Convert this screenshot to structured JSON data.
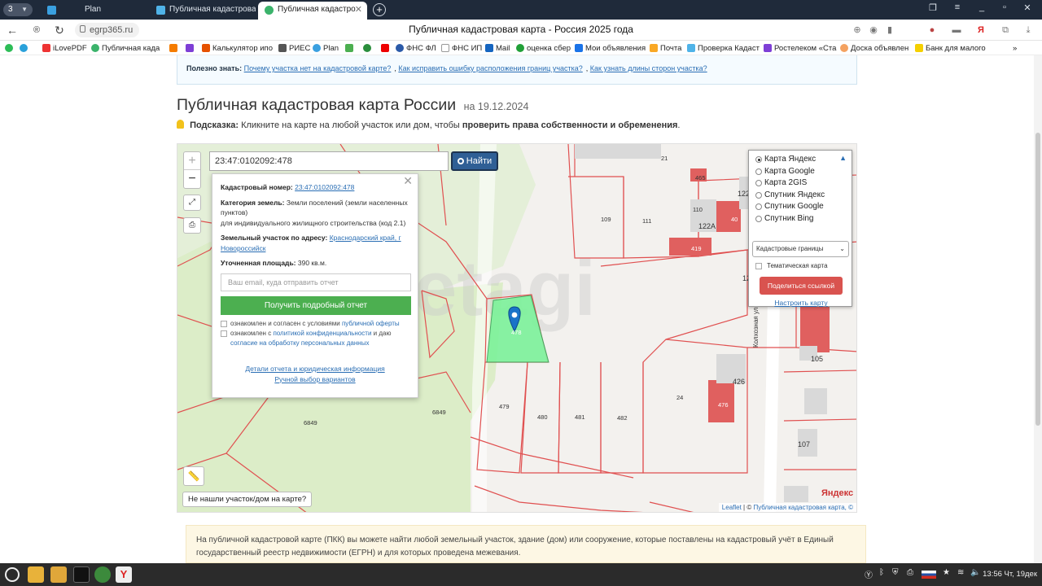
{
  "browser": {
    "tab_count": "3",
    "tabs": [
      {
        "label": "Plan"
      },
      {
        "label": "Публичная кадастрова"
      },
      {
        "label": "Публичная кадастро"
      }
    ],
    "url": "egrp365.ru",
    "page_title": "Публичная кадастровая карта - Россия 2025 года",
    "bookmarks": [
      "iLovePDF",
      "Публичная када",
      "Калькулятор ипо",
      "РИЕС",
      "Plan",
      "ФНС ФЛ",
      "ФНС ИП",
      "Mail",
      "оценка сбер",
      "Мои объявления",
      "Почта",
      "Проверка Кадаст",
      "Ростелеком «Ста",
      "Доска объявлен",
      "Банк для малого"
    ]
  },
  "info_box": {
    "label": "Полезно знать:",
    "links": [
      "Почему участка нет на кадастровой карте?",
      "Как исправить ошибку расположения границ участка?",
      "Как узнать длины сторон участка?"
    ]
  },
  "heading": {
    "title": "Публичная кадастровая карта России",
    "date": "на 19.12.2024"
  },
  "hint": {
    "label": "Подсказка:",
    "text": "Кликните на карте на любой участок или дом, чтобы",
    "bold": "проверить права собственности и обременения",
    "end": "."
  },
  "map": {
    "search_value": "23:47:0102092:478",
    "search_button": "Найти",
    "zoom_in": "+",
    "zoom_out": "−",
    "watermark": "etagi",
    "parcel_labels": [
      "21",
      "465",
      "109",
      "111",
      "110",
      "122A",
      "122",
      "40",
      "419",
      "478",
      "479",
      "480",
      "481",
      "482",
      "24",
      "6849",
      "6849",
      "426",
      "476",
      "105",
      "107",
      "12"
    ],
    "street_label": "Колхозная ул.",
    "popup": {
      "cad_label": "Кадастровый номер:",
      "cad_value": "23:47:0102092:478",
      "cat_label": "Категория земель:",
      "cat_value": "Земли поселений (земли населенных пунктов)",
      "use_value": "для индивидуального жилищного строительства (код 2.1)",
      "addr_label": "Земельный участок по адресу:",
      "addr_value": "Краснодарский край, г Новороссийск",
      "area_label": "Уточненная площадь:",
      "area_value": "390 кв.м.",
      "email_placeholder": "Ваш email, куда отправить отчет",
      "report_button": "Получить подробный отчет",
      "agree1_text": "ознакомлен и согласен с условиями",
      "agree1_link": "публичной оферты",
      "agree2_text": "ознакомлен с",
      "agree2_link": "политикой конфиденциальности",
      "agree2_mid": "и даю",
      "agree2_link2": "согласие на обработку персональных данных",
      "details_link": "Детали отчета и юридическая информация",
      "manual_link": "Ручной выбор вариантов"
    },
    "layers": {
      "options": [
        "Карта Яндекс",
        "Карта Google",
        "Карта 2GIS",
        "Спутник Яндекс",
        "Спутник Google",
        "Спутник Bing"
      ],
      "selected": 0,
      "overlay_select": "Кадастровые границы",
      "thematic": "Тематическая карта",
      "share_button": "Поделиться ссылкой",
      "configure_link": "Настроить карту"
    },
    "not_found": "Не нашли участок/дом на карте?",
    "yandex_logo": "Яндекс",
    "attribution_leaflet": "Leaflet",
    "attribution_sep": " | © ",
    "attribution_pkk": "Публичная кадастровая карта, ©"
  },
  "notice": "На публичной кадастровой карте (ПКК) вы можете найти любой земельный участок, здание (дом) или сооружение, которые поставлены на кадастровый учёт в Единый государственный реестр недвижимости (ЕГРН) и для которых проведена межевания.",
  "taskbar": {
    "clock": "13:56 Чт, 19дек"
  },
  "colors": {
    "parcel_border": "#e05050",
    "selected_parcel": "#7cf29a",
    "building": "#e0605f",
    "forest": "#dcedc8",
    "accent_blue": "#2f5f95",
    "green_button": "#4caf50",
    "share_red": "#d9534f"
  }
}
